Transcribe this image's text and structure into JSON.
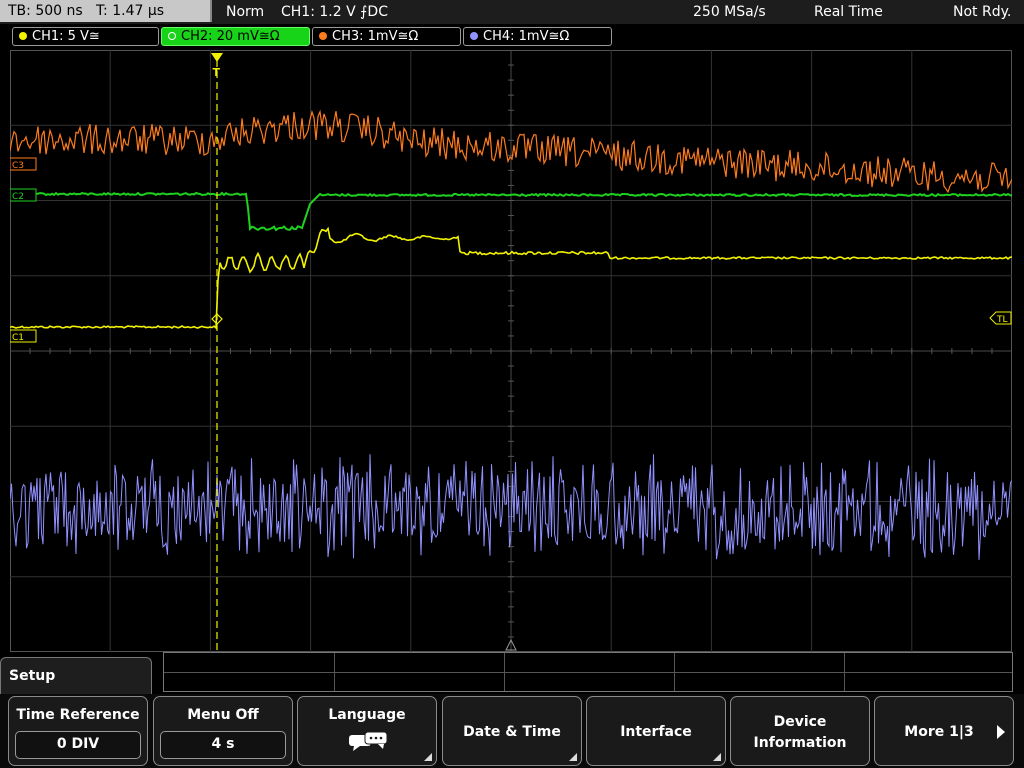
{
  "status_bar": {
    "timebase": "TB: 500 ns",
    "trigger_time": "T: 1.47 µs",
    "trigger_mode": "Norm",
    "trigger_source": "CH1: 1.2 V",
    "trigger_slope_coupling": "⨍DC",
    "sample_rate": "250 MSa/s",
    "acquisition_mode": "Real Time",
    "trigger_status": "Not Rdy."
  },
  "channels": [
    {
      "label": "CH1: 5 V≅",
      "color": "#f2f200",
      "active": false
    },
    {
      "label": "CH2: 20 mV≅Ω",
      "color": "#1fd11f",
      "active": true
    },
    {
      "label": "CH3: 1mV≅Ω",
      "color": "#ff7b1c",
      "active": false
    },
    {
      "label": "CH4: 1mV≅Ω",
      "color": "#9090ff",
      "active": false
    }
  ],
  "markers": {
    "c1": "C1",
    "c2": "C2",
    "c3": "C3",
    "trigger_level": "TL",
    "trigger_position": "T"
  },
  "menu": {
    "title": "Setup",
    "softkeys": [
      {
        "label": "Time Reference",
        "value": "0 DIV"
      },
      {
        "label": "Menu Off",
        "value": "4 s"
      },
      {
        "label": "Language",
        "icon": "speech-bubbles-icon"
      },
      {
        "label": "Date & Time"
      },
      {
        "label": "Interface"
      },
      {
        "label": "Device",
        "label2": "Information"
      },
      {
        "label": "More 1|3"
      }
    ]
  },
  "colors": {
    "ch1": "#f2f200",
    "ch2": "#1fd11f",
    "ch3": "#ff7b1c",
    "ch4": "#9090ff",
    "grid": "#3a3a3a",
    "trigger_line": "#f2f200"
  }
}
